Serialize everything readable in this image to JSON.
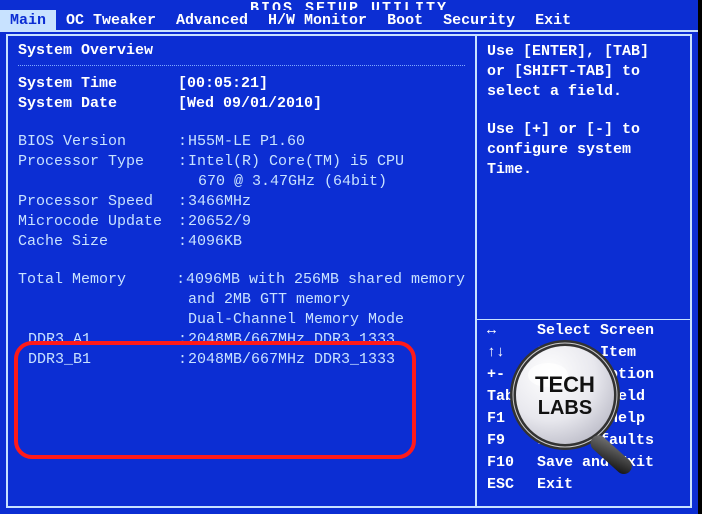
{
  "title": "BIOS SETUP UTILITY",
  "menu": {
    "items": [
      "Main",
      "OC Tweaker",
      "Advanced",
      "H/W Monitor",
      "Boot",
      "Security",
      "Exit"
    ],
    "active_index": 0
  },
  "left": {
    "heading": "System Overview",
    "system_time_label": "System Time",
    "system_time_value": "[00:05:21]",
    "system_date_label": "System Date",
    "system_date_value": "[Wed 09/01/2010]",
    "bios_version_label": "BIOS Version",
    "bios_version_value": "H55M-LE P1.60",
    "processor_type_label": "Processor Type",
    "processor_type_value": "Intel(R) Core(TM) i5 CPU",
    "processor_type_value2": "670  @ 3.47GHz (64bit)",
    "processor_speed_label": "Processor Speed",
    "processor_speed_value": "3466MHz",
    "microcode_label": "Microcode Update",
    "microcode_value": "20652/9",
    "cache_size_label": "Cache Size",
    "cache_size_value": "4096KB",
    "total_memory_label": "Total Memory",
    "total_memory_value": "4096MB with 256MB shared memory",
    "total_memory_value2": "and 2MB GTT memory",
    "memory_mode": "Dual-Channel Memory Mode",
    "ddr3_a1_label": "DDR3_A1",
    "ddr3_a1_value": "2048MB/667MHz DDR3_1333",
    "ddr3_b1_label": "DDR3_B1",
    "ddr3_b1_value": "2048MB/667MHz DDR3_1333"
  },
  "right": {
    "help1": "Use [ENTER], [TAB]",
    "help2": "or [SHIFT-TAB] to",
    "help3": "select a field.",
    "help4": "Use [+] or [-] to",
    "help5": "configure system Time.",
    "keys": [
      {
        "sym": "↔",
        "label": "Select Screen"
      },
      {
        "sym": "↑↓",
        "label": "Select Item"
      },
      {
        "sym": "+-",
        "label": "Change Option"
      },
      {
        "sym": "Tab",
        "label": "Select Field"
      },
      {
        "sym": "F1",
        "label": "General Help"
      },
      {
        "sym": "F9",
        "label": "Load Defaults"
      },
      {
        "sym": "F10",
        "label": "Save and Exit"
      },
      {
        "sym": "ESC",
        "label": "Exit"
      }
    ]
  },
  "watermark": "TECH LABS"
}
